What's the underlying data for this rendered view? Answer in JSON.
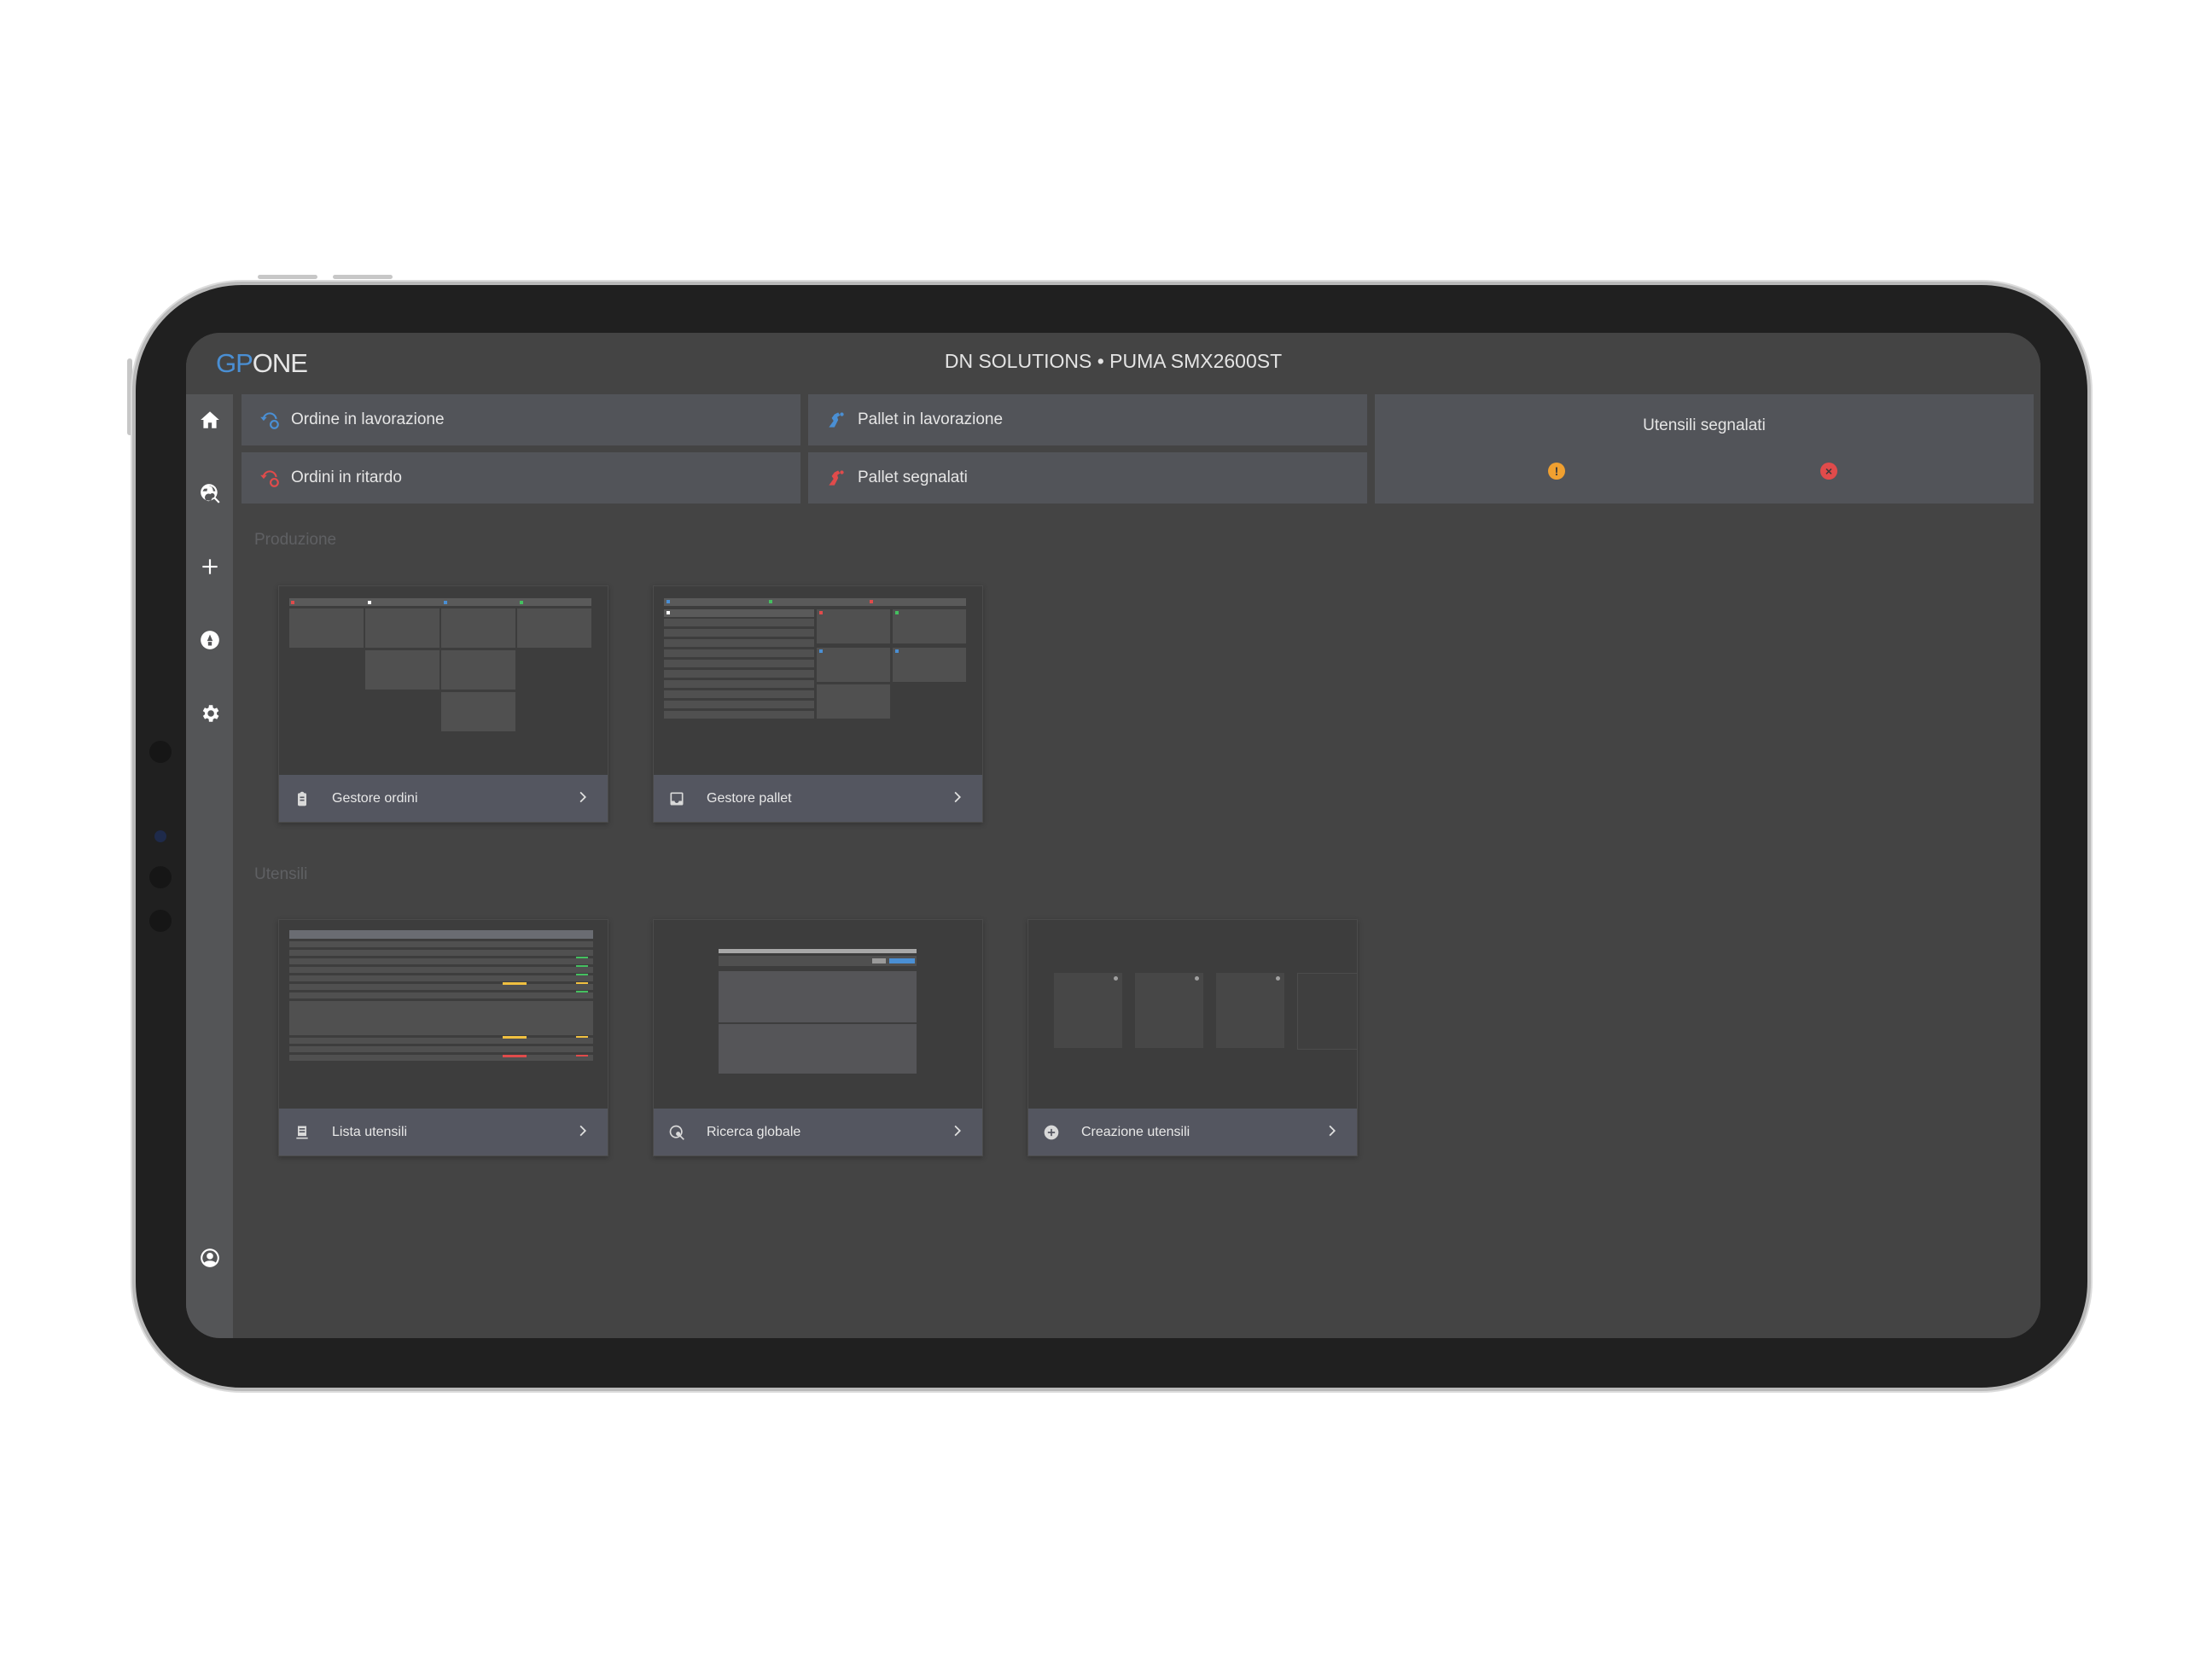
{
  "header": {
    "logo_gp": "GP",
    "logo_one": "ONE",
    "machine_title": "DN SOLUTIONS • PUMA SMX2600ST"
  },
  "sidebar": {
    "items": [
      {
        "name": "home",
        "icon": "home-icon"
      },
      {
        "name": "search",
        "icon": "global-search-icon"
      },
      {
        "name": "add",
        "icon": "plus-icon"
      },
      {
        "name": "tools",
        "icon": "tool-circle-icon"
      },
      {
        "name": "settings",
        "icon": "gear-icon"
      },
      {
        "name": "account",
        "icon": "user-circle-icon"
      }
    ]
  },
  "stats": {
    "ordine_in_lavorazione": "Ordine in lavorazione",
    "ordini_in_ritardo": "Ordini in ritardo",
    "pallet_in_lavorazione": "Pallet in lavorazione",
    "pallet_segnalati": "Pallet segnalati",
    "utensili_segnalati": "Utensili segnalati",
    "warning_badge": "!",
    "error_badge": "×"
  },
  "colors": {
    "accent_blue": "#4a8fd4",
    "alert_red": "#e04b4b",
    "warning_orange": "#f0a030",
    "background": "#444444",
    "sidebar": "#545557"
  },
  "sections": {
    "produzione": "Produzione",
    "utensili": "Utensili"
  },
  "cards": {
    "gestore_ordini": "Gestore ordini",
    "gestore_pallet": "Gestore pallet",
    "lista_utensili": "Lista utensili",
    "ricerca_globale": "Ricerca globale",
    "creazione_utensili": "Creazione utensili"
  }
}
